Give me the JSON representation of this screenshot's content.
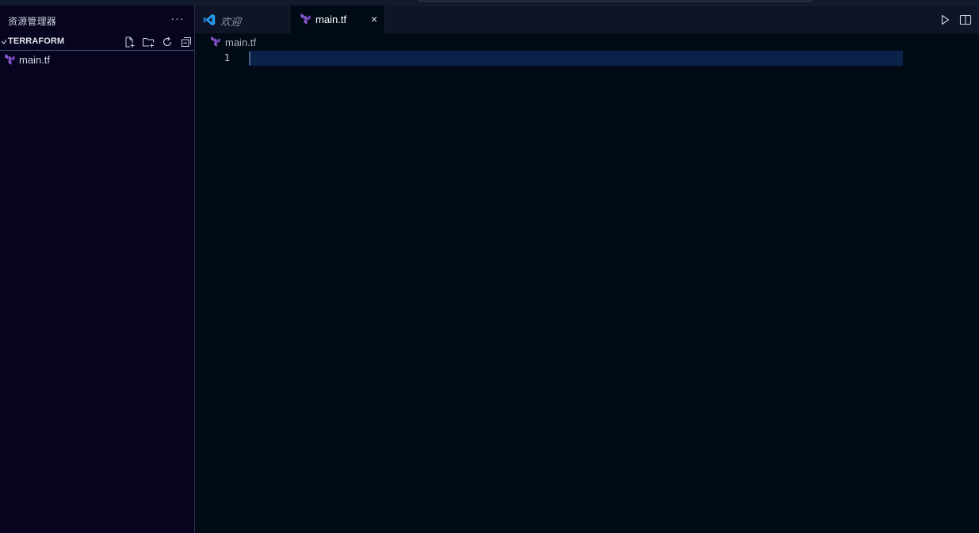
{
  "sidebar": {
    "title": "资源管理器",
    "more_label": "···",
    "section": {
      "chevron": "✓",
      "title": "TERRAFORM",
      "actions": [
        "new-file-icon",
        "new-folder-icon",
        "refresh-icon",
        "collapse-all-icon"
      ]
    },
    "files": [
      {
        "name": "main.tf",
        "icon": "terraform-icon"
      }
    ]
  },
  "tabs": [
    {
      "label": "欢迎",
      "icon": "vscode-icon",
      "active": false
    },
    {
      "label": "main.tf",
      "icon": "terraform-icon",
      "active": true,
      "close": "×"
    }
  ],
  "editor_actions": [
    "run-icon",
    "split-editor-icon"
  ],
  "breadcrumb": {
    "file": "main.tf"
  },
  "editor": {
    "line_numbers": [
      "1"
    ],
    "lines": [
      ""
    ]
  },
  "colors": {
    "terraform": "#7b42bc",
    "vscode": "#2b9bf0",
    "current_line": "#0a2149",
    "sidebar_bg": "#06041f",
    "editor_bg": "#010b16"
  }
}
